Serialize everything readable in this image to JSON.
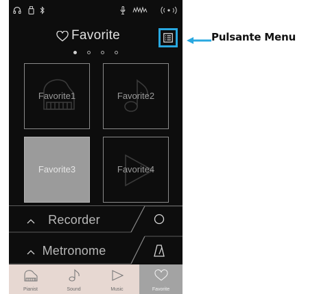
{
  "header": {
    "title": "Favorite"
  },
  "tiles": [
    {
      "label": "Favorite1",
      "icon": "piano-icon",
      "selected": false
    },
    {
      "label": "Favorite2",
      "icon": "music-note-icon",
      "selected": false
    },
    {
      "label": "Favorite3",
      "icon": "none",
      "selected": true
    },
    {
      "label": "Favorite4",
      "icon": "play-icon",
      "selected": false
    }
  ],
  "pager": {
    "pages": 4,
    "current": 1
  },
  "recorder": {
    "label": "Recorder"
  },
  "metronome": {
    "label": "Metronome"
  },
  "tabs": [
    {
      "label": "Pianist",
      "icon": "piano-icon"
    },
    {
      "label": "Sound",
      "icon": "music-note-icon"
    },
    {
      "label": "Music",
      "icon": "play-icon"
    },
    {
      "label": "Favorite",
      "icon": "heart-icon",
      "active": true
    }
  ],
  "callout": {
    "text": "Pulsante Menu"
  },
  "colors": {
    "accent": "#29a8e0",
    "background": "#0d0d0d",
    "tabbar": "#e7d8d2",
    "active_tab": "#a3a3a3"
  }
}
